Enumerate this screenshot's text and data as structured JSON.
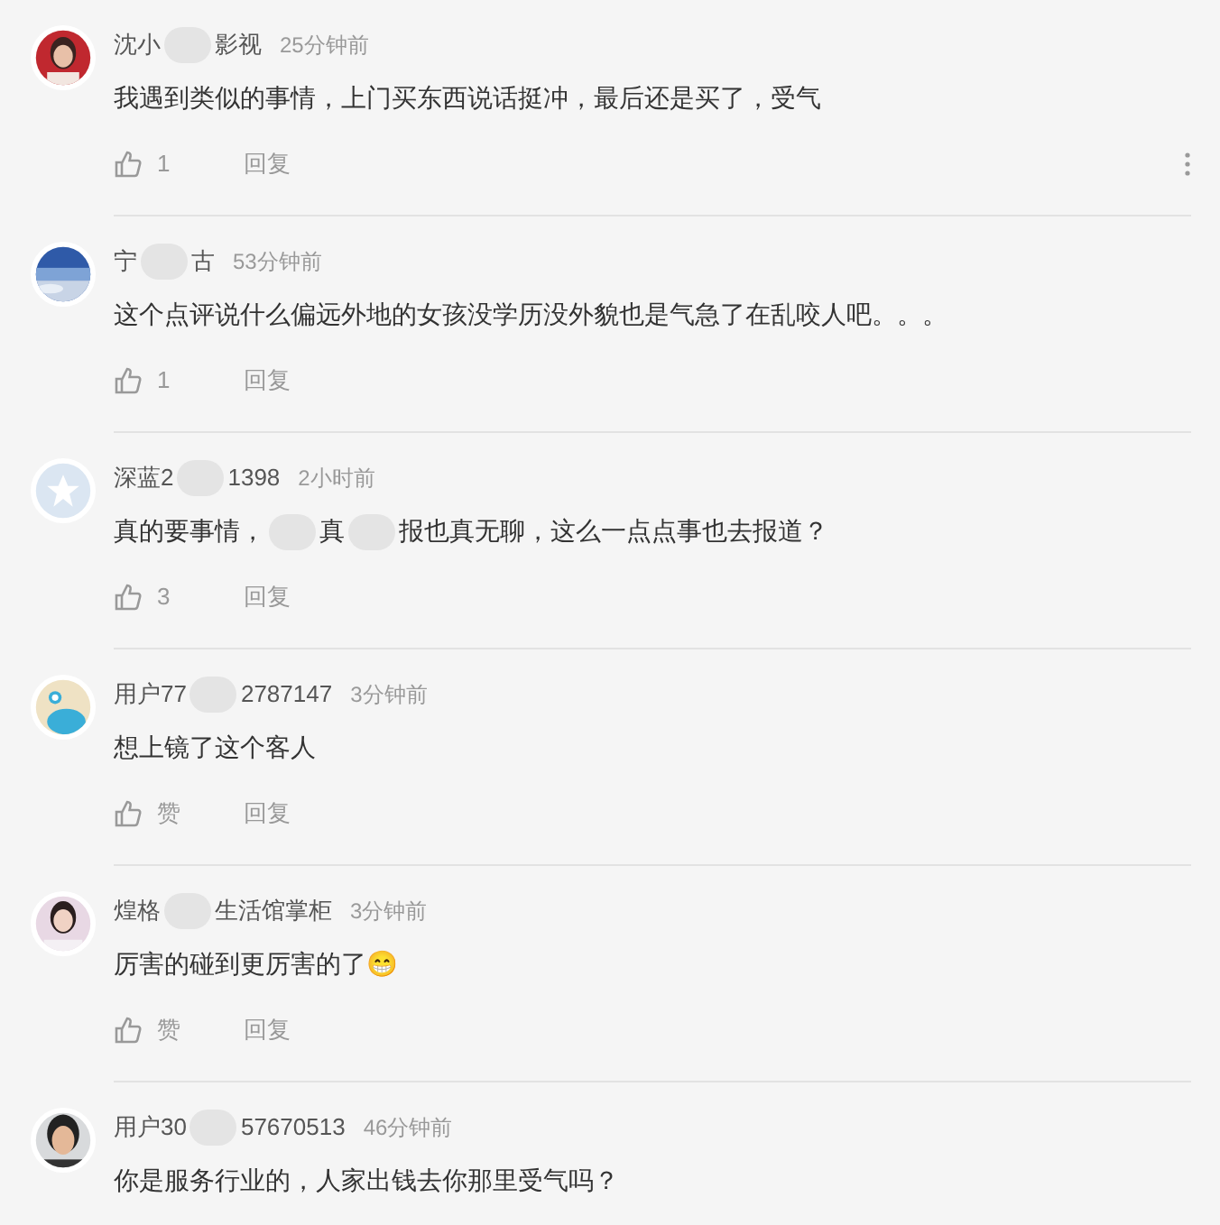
{
  "comments": [
    {
      "name_parts": [
        "沈小",
        "影视"
      ],
      "time": "25分钟前",
      "text_parts": [
        "我遇到类似的事情，上门买东西说话挺冲，最后还是买了，受气"
      ],
      "like": "1",
      "reply": "回复",
      "more": true
    },
    {
      "name_parts": [
        "宁",
        "古"
      ],
      "time": "53分钟前",
      "text_parts": [
        "这个点评说什么偏远外地的女孩没学历没外貌也是气急了在乱咬人吧。。。"
      ],
      "like": "1",
      "reply": "回复",
      "more": false
    },
    {
      "name_parts": [
        "深蓝2",
        "1398"
      ],
      "time": "2小时前",
      "text_parts": [
        "真的要事情，",
        "真",
        "报也真无聊，这么一点点事也去报道？"
      ],
      "like": "3",
      "reply": "回复",
      "more": false
    },
    {
      "name_parts": [
        "用户77",
        "2787147"
      ],
      "time": "3分钟前",
      "text_parts": [
        "想上镜了这个客人"
      ],
      "like": "赞",
      "reply": "回复",
      "more": false
    },
    {
      "name_parts": [
        "煌格",
        "生活馆掌柜"
      ],
      "time": "3分钟前",
      "text_parts": [
        "厉害的碰到更厉害的了😁"
      ],
      "like": "赞",
      "reply": "回复",
      "more": false
    },
    {
      "name_parts": [
        "用户30",
        "57670513"
      ],
      "time": "46分钟前",
      "text_parts": [
        "你是服务行业的，人家出钱去你那里受气吗？"
      ]
    }
  ]
}
